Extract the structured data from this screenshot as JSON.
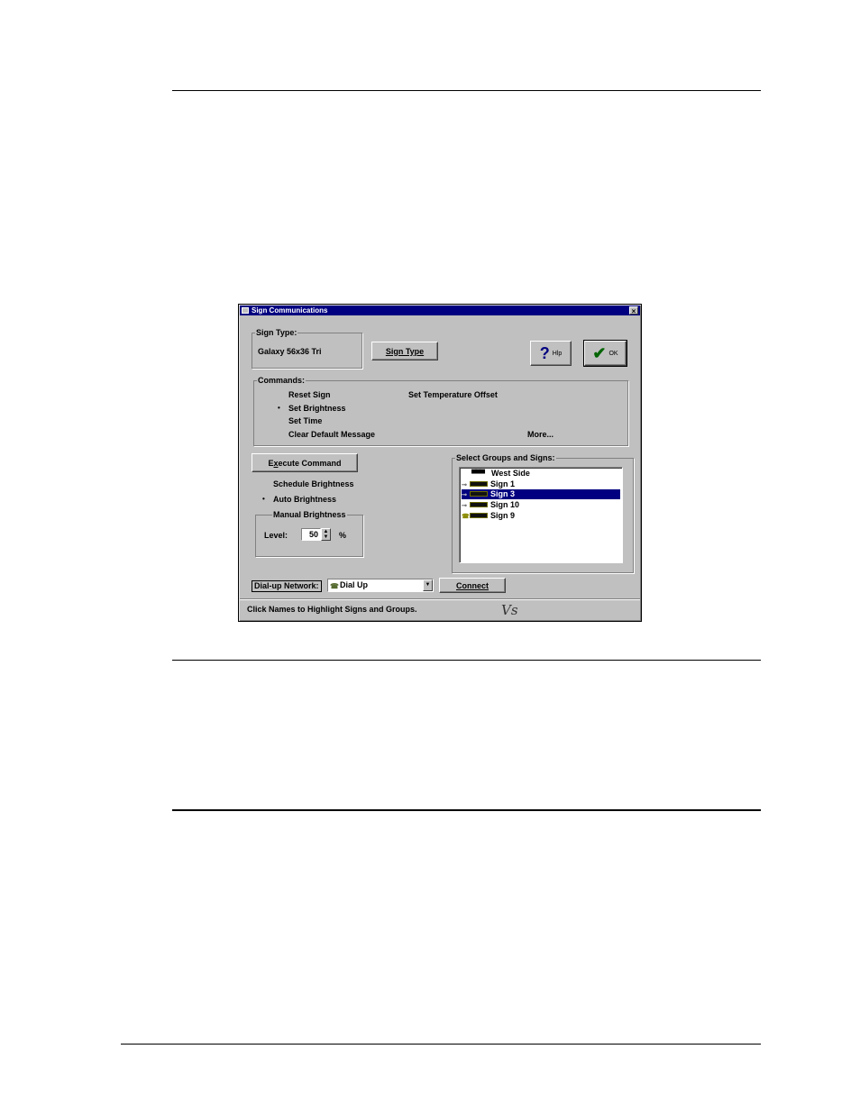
{
  "dialog": {
    "title": "Sign Communications",
    "close_glyph": "×",
    "sign_type": {
      "group_label": "Sign Type:",
      "value": "Galaxy 56x36 Tri",
      "button_label": "Sign Type"
    },
    "help_button": {
      "glyph": "?",
      "label": "Hlp"
    },
    "ok_button": {
      "glyph": "✔",
      "label": "OK"
    },
    "commands": {
      "group_label": "Commands:",
      "items": [
        {
          "label": "Reset Sign",
          "selected": false
        },
        {
          "label": "Set Brightness",
          "selected": true
        },
        {
          "label": "Set Time",
          "selected": false
        },
        {
          "label": "Clear Default Message",
          "selected": false
        },
        {
          "label": "Set Temperature Offset",
          "selected": false
        }
      ],
      "more_label": "More..."
    },
    "execute_button": {
      "label_prefix": "E",
      "label_underline": "x",
      "label_rest": "ecute Command"
    },
    "brightness": {
      "schedule_label": "Schedule Brightness",
      "auto_label": "Auto Brightness",
      "auto_selected": true,
      "manual_label": "Manual Brightness",
      "level_label": "Level:",
      "level_value": "50",
      "level_unit": "%"
    },
    "groups": {
      "group_label": "Select Groups and Signs:",
      "items": [
        {
          "label": "West Side",
          "kind": "group",
          "selected": false
        },
        {
          "label": "Sign 1",
          "kind": "sign",
          "selected": false
        },
        {
          "label": "Sign 3",
          "kind": "sign",
          "selected": true
        },
        {
          "label": "Sign 10",
          "kind": "sign",
          "selected": false
        },
        {
          "label": "Sign 9",
          "kind": "sign",
          "selected": false
        }
      ]
    },
    "network": {
      "label": "Dial-up Network:",
      "selected": "Dial Up",
      "connect_label": "Connect"
    },
    "status_text": "Click Names to Highlight Signs and Groups.",
    "handwritten_mark": "Vs"
  }
}
